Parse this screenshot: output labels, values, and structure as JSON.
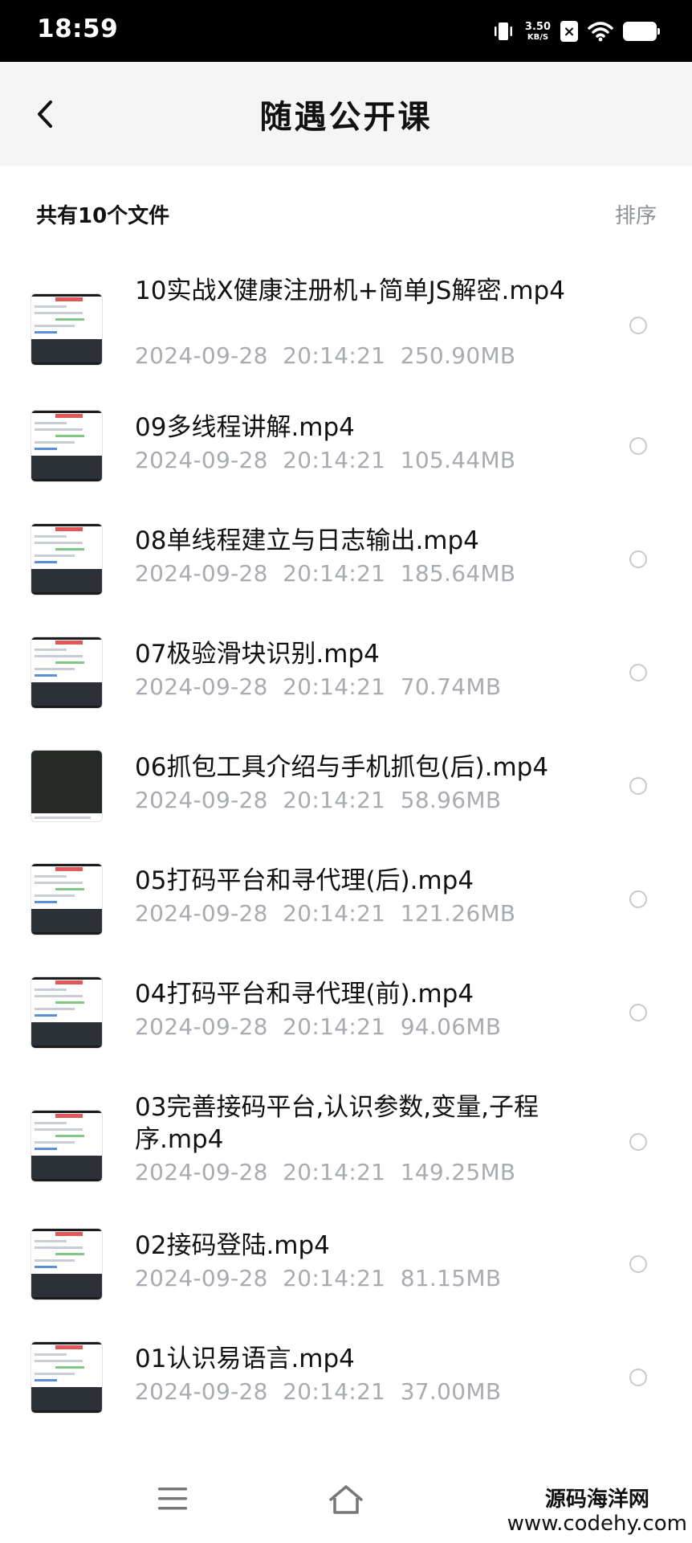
{
  "status_bar": {
    "time": "18:59",
    "net_speed_value": "3.50",
    "net_speed_unit": "KB/S",
    "icons": [
      "vibrate-icon",
      "no-sim-icon",
      "wifi-icon",
      "battery-icon"
    ]
  },
  "header": {
    "back_icon": "chevron-left-icon",
    "title": "随遇公开课"
  },
  "summary": {
    "file_count": "共有10个文件",
    "sort_label": "排序"
  },
  "files": [
    {
      "name": "10实战X健康注册机+简单JS解密.mp4",
      "date": "2024-09-28",
      "time": "20:14:21",
      "size": "250.90MB"
    },
    {
      "name": "09多线程讲解.mp4",
      "date": "2024-09-28",
      "time": "20:14:21",
      "size": "105.44MB"
    },
    {
      "name": "08单线程建立与日志输出.mp4",
      "date": "2024-09-28",
      "time": "20:14:21",
      "size": "185.64MB"
    },
    {
      "name": "07极验滑块识别.mp4",
      "date": "2024-09-28",
      "time": "20:14:21",
      "size": "70.74MB"
    },
    {
      "name": "06抓包工具介绍与手机抓包(后).mp4",
      "date": "2024-09-28",
      "time": "20:14:21",
      "size": "58.96MB"
    },
    {
      "name": "05打码平台和寻代理(后).mp4",
      "date": "2024-09-28",
      "time": "20:14:21",
      "size": "121.26MB"
    },
    {
      "name": "04打码平台和寻代理(前).mp4",
      "date": "2024-09-28",
      "time": "20:14:21",
      "size": "94.06MB"
    },
    {
      "name": "03完善接码平台,认识参数,变量,子程序.mp4",
      "date": "2024-09-28",
      "time": "20:14:21",
      "size": "149.25MB"
    },
    {
      "name": "02接码登陆.mp4",
      "date": "2024-09-28",
      "time": "20:14:21",
      "size": "81.15MB"
    },
    {
      "name": "01认识易语言.mp4",
      "date": "2024-09-28",
      "time": "20:14:21",
      "size": "37.00MB"
    }
  ],
  "bottom_nav": {
    "icons": [
      "menu-icon",
      "home-icon"
    ]
  },
  "watermark": {
    "line1": "源码海洋网",
    "line2": "www.codehy.com"
  }
}
